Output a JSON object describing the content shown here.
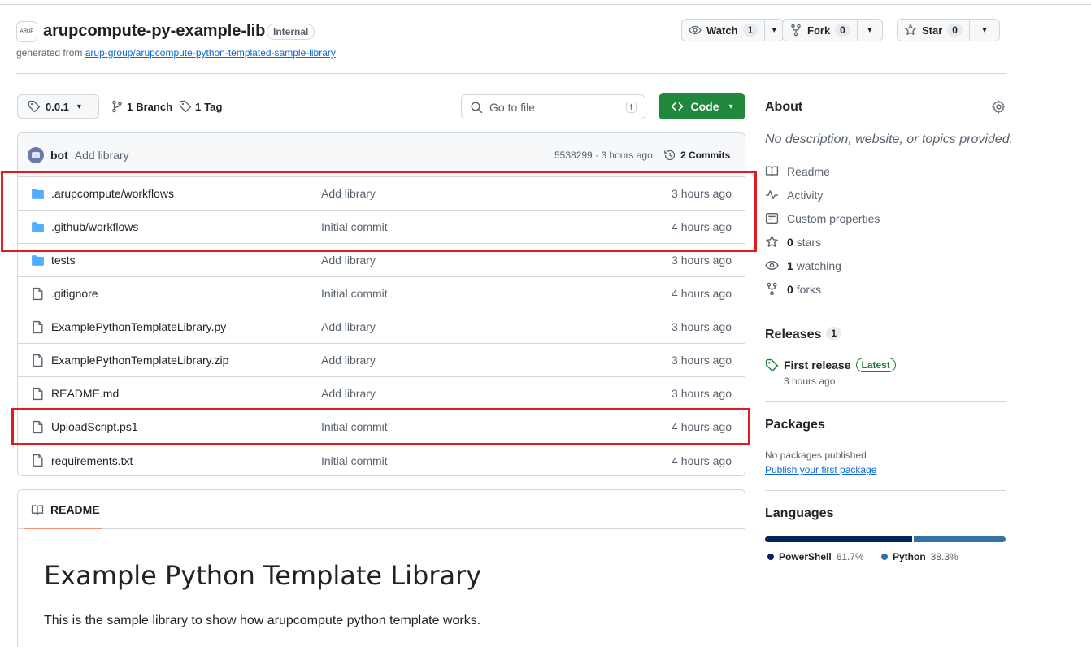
{
  "header": {
    "avatar_text": "ARUP",
    "repo_name": "arupcompute-py-example-lib",
    "visibility": "Internal",
    "generated_prefix": "generated from",
    "generated_link": "arup-group/arupcompute-python-templated-sample-library",
    "watch": {
      "label": "Watch",
      "count": "1"
    },
    "fork": {
      "label": "Fork",
      "count": "0"
    },
    "star": {
      "label": "Star",
      "count": "0"
    }
  },
  "toolbar": {
    "tag_selector": "0.0.1",
    "branches_count": "1",
    "branches_label": "Branch",
    "tags_count": "1",
    "tags_label": "Tag",
    "go_to_file_placeholder": "Go to file",
    "go_to_file_kbd": "t",
    "code_label": "Code"
  },
  "latest_commit": {
    "author": "bot",
    "message": "Add library",
    "meta": "5538299 · 3 hours ago",
    "commits_label": "2 Commits"
  },
  "files": [
    {
      "type": "folder",
      "name": ".arupcompute/workflows",
      "message": "Add library",
      "date": "3 hours ago"
    },
    {
      "type": "folder",
      "name": ".github/workflows",
      "message": "Initial commit",
      "date": "4 hours ago"
    },
    {
      "type": "folder",
      "name": "tests",
      "message": "Add library",
      "date": "3 hours ago"
    },
    {
      "type": "file",
      "name": ".gitignore",
      "message": "Initial commit",
      "date": "4 hours ago"
    },
    {
      "type": "file",
      "name": "ExamplePythonTemplateLibrary.py",
      "message": "Add library",
      "date": "3 hours ago"
    },
    {
      "type": "file",
      "name": "ExamplePythonTemplateLibrary.zip",
      "message": "Add library",
      "date": "3 hours ago"
    },
    {
      "type": "file",
      "name": "README.md",
      "message": "Add library",
      "date": "3 hours ago"
    },
    {
      "type": "file",
      "name": "UploadScript.ps1",
      "message": "Initial commit",
      "date": "4 hours ago"
    },
    {
      "type": "file",
      "name": "requirements.txt",
      "message": "Initial commit",
      "date": "4 hours ago"
    }
  ],
  "readme": {
    "tab_label": "README",
    "heading": "Example Python Template Library",
    "body": "This is the sample library to show how arupcompute python template works."
  },
  "about": {
    "title": "About",
    "description": "No description, website, or topics provided.",
    "readme": "Readme",
    "activity": "Activity",
    "custom_properties": "Custom properties",
    "stars_count": "0",
    "stars_label": "stars",
    "watching_count": "1",
    "watching_label": "watching",
    "forks_count": "0",
    "forks_label": "forks"
  },
  "releases": {
    "title": "Releases",
    "count": "1",
    "name": "First release",
    "badge": "Latest",
    "date": "3 hours ago"
  },
  "packages": {
    "title": "Packages",
    "none": "No packages published",
    "link": "Publish your first package"
  },
  "languages": {
    "title": "Languages",
    "items": [
      {
        "name": "PowerShell",
        "percent": "61.7%",
        "value": 61.7,
        "color": "#012456"
      },
      {
        "name": "Python",
        "percent": "38.3%",
        "value": 38.3,
        "color": "#3572A5"
      }
    ]
  },
  "colors": {
    "highlight": "#e01b24",
    "code_button": "#1f883d",
    "folder": "#54aeff"
  }
}
